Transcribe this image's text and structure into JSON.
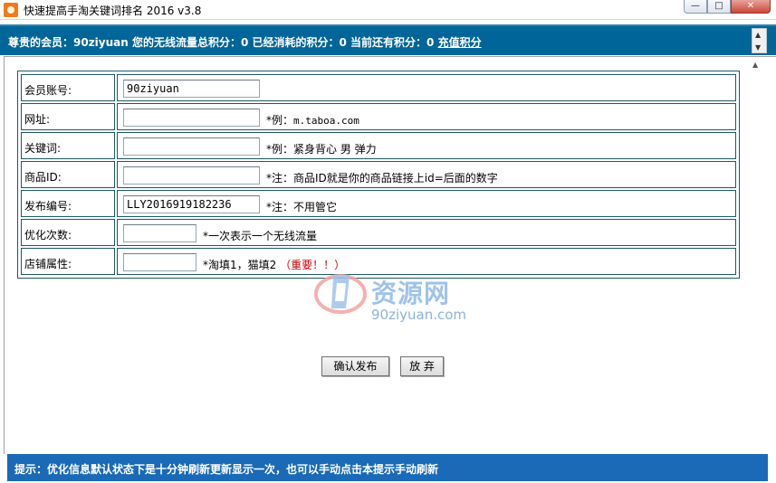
{
  "window": {
    "title": "快速提高手淘关键词排名 2016 v3.8",
    "min_glyph": "—",
    "max_glyph": "□",
    "close_glyph": "✕"
  },
  "infobar": {
    "text": "尊贵的会员：90ziyuan 您的无线流量总积分：0 已经消耗的积分：0 当前还有积分：0 ",
    "recharge": "充值积分",
    "scroll_up": "▲",
    "scroll_down": "▼"
  },
  "form": {
    "account": {
      "label": "会员账号:",
      "value": "90ziyuan"
    },
    "url": {
      "label": "网址:",
      "value": "",
      "hint_prefix": "*例：",
      "hint_mono": "m.taboa.com"
    },
    "keyword": {
      "label": "关键词:",
      "value": "",
      "hint": "*例：紧身背心 男 弹力"
    },
    "product_id": {
      "label": "商品ID:",
      "value": "",
      "hint": "*注：商品ID就是你的商品链接上id=后面的数字"
    },
    "publish_no": {
      "label": "发布编号:",
      "value": "LLY2016919182236",
      "hint": "*注：不用管它"
    },
    "optimize_count": {
      "label": "优化次数:",
      "value": "",
      "hint": "*一次表示一个无线流量"
    },
    "shop_type": {
      "label": "店铺属性:",
      "value": "",
      "hint": "*淘填1，猫填2 ",
      "important": "（重要！！）"
    }
  },
  "buttons": {
    "confirm": "确认发布",
    "cancel": "放 弃"
  },
  "watermark": {
    "title": "资源网",
    "url": "90ziyuan.com"
  },
  "tipbar": {
    "text": "提示：优化信息默认状态下是十分钟刷新更新显示一次，也可以手动点击本提示手动刷新"
  },
  "colors": {
    "infobar": "#006699",
    "tipbar": "#1a6ab8",
    "table_border": "#1e5a63",
    "important": "#cc0000"
  }
}
